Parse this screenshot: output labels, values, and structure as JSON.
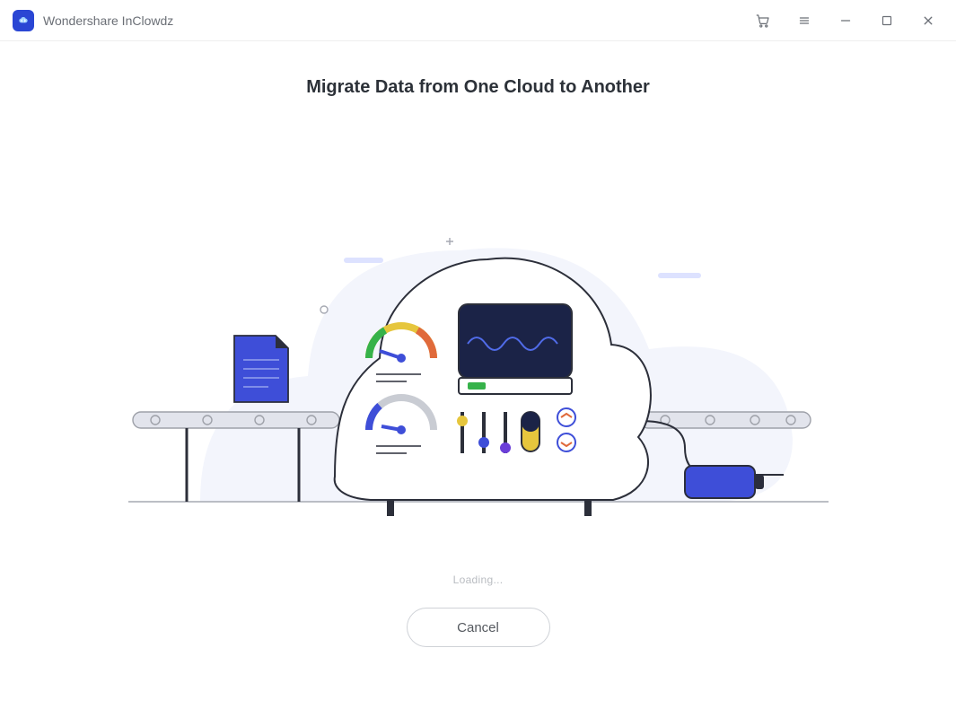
{
  "titlebar": {
    "app_name": "Wondershare InClowdz"
  },
  "main": {
    "title": "Migrate Data from One Cloud to Another",
    "status": "Loading...",
    "cancel_label": "Cancel"
  },
  "colors": {
    "accent": "#2a46d4"
  }
}
